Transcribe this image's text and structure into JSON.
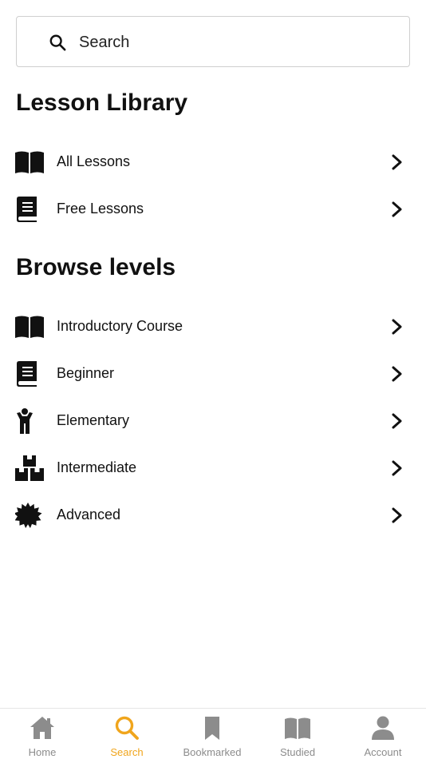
{
  "search": {
    "placeholder": "Search",
    "icon": "search-icon"
  },
  "library": {
    "title": "Lesson Library",
    "items": [
      {
        "label": "All Lessons",
        "icon": "open-book-icon"
      },
      {
        "label": "Free Lessons",
        "icon": "closed-book-icon"
      }
    ]
  },
  "levels": {
    "title": "Browse levels",
    "items": [
      {
        "label": "Introductory Course",
        "icon": "open-book-icon"
      },
      {
        "label": "Beginner",
        "icon": "closed-book-icon"
      },
      {
        "label": "Elementary",
        "icon": "child-icon"
      },
      {
        "label": "Intermediate",
        "icon": "boxes-icon"
      },
      {
        "label": "Advanced",
        "icon": "badge-icon"
      }
    ]
  },
  "tabbar": {
    "active_color": "#f0a51c",
    "inactive_color": "#8c8c8c",
    "tabs": [
      {
        "label": "Home",
        "icon": "home-icon",
        "active": false
      },
      {
        "label": "Search",
        "icon": "search-icon",
        "active": true
      },
      {
        "label": "Bookmarked",
        "icon": "bookmark-icon",
        "active": false
      },
      {
        "label": "Studied",
        "icon": "open-book-icon",
        "active": false
      },
      {
        "label": "Account",
        "icon": "person-icon",
        "active": false
      }
    ]
  }
}
